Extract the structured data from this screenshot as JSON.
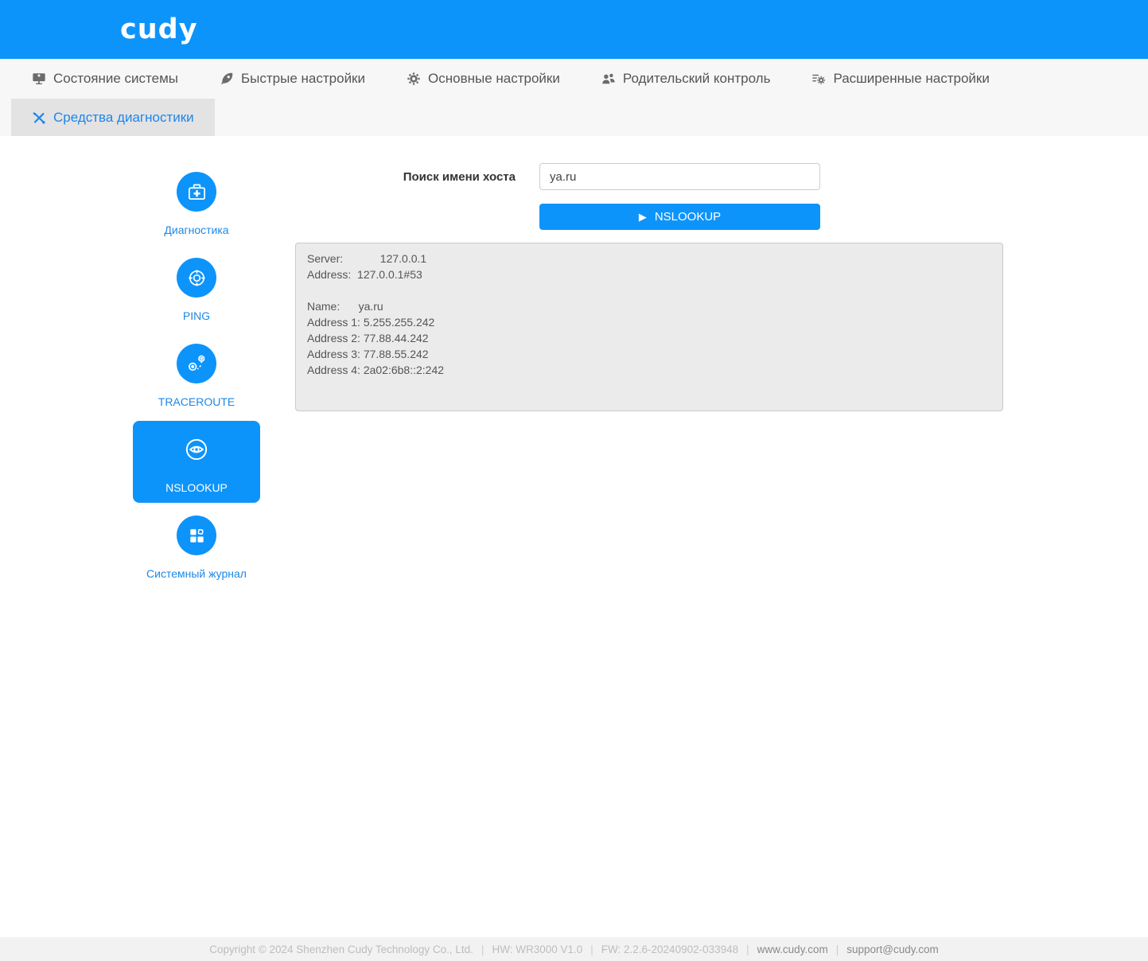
{
  "brand": {
    "logo": "cudy",
    "blue": "#0d94fb"
  },
  "nav": {
    "items": [
      {
        "label": "Состояние системы",
        "icon": "monitor-icon"
      },
      {
        "label": "Быстрые настройки",
        "icon": "rocket-icon"
      },
      {
        "label": "Основные настройки",
        "icon": "gear-icon"
      },
      {
        "label": "Родительский контроль",
        "icon": "users-icon"
      },
      {
        "label": "Расширенные настройки",
        "icon": "sliders-gear-icon"
      }
    ],
    "active_tab": {
      "label": "Средства диагностики",
      "icon": "tools-icon"
    }
  },
  "sidebar": {
    "items": [
      {
        "label": "Диагностика",
        "icon": "first-aid-icon"
      },
      {
        "label": "PING",
        "icon": "target-icon"
      },
      {
        "label": "TRACEROUTE",
        "icon": "route-icon"
      },
      {
        "label": "NSLOOKUP",
        "icon": "eye-icon"
      },
      {
        "label": "Системный журнал",
        "icon": "grid-icon"
      }
    ],
    "active": "NSLOOKUP"
  },
  "form": {
    "host_label": "Поиск имени хоста",
    "host_value": "ya.ru",
    "submit_label": "NSLOOKUP",
    "play_glyph": "▶"
  },
  "result": {
    "lines": [
      "Server:            127.0.0.1",
      "Address:  127.0.0.1#53",
      "",
      "Name:      ya.ru",
      "Address 1: 5.255.255.242",
      "Address 2: 77.88.44.242",
      "Address 3: 77.88.55.242",
      "Address 4: 2a02:6b8::2:242"
    ]
  },
  "footer": {
    "copyright": "Copyright © 2024 Shenzhen Cudy Technology Co., Ltd.",
    "hw": "HW: WR3000 V1.0",
    "fw": "FW: 2.2.6-20240902-033948",
    "site": "www.cudy.com",
    "email": "support@cudy.com",
    "separator": "|"
  }
}
